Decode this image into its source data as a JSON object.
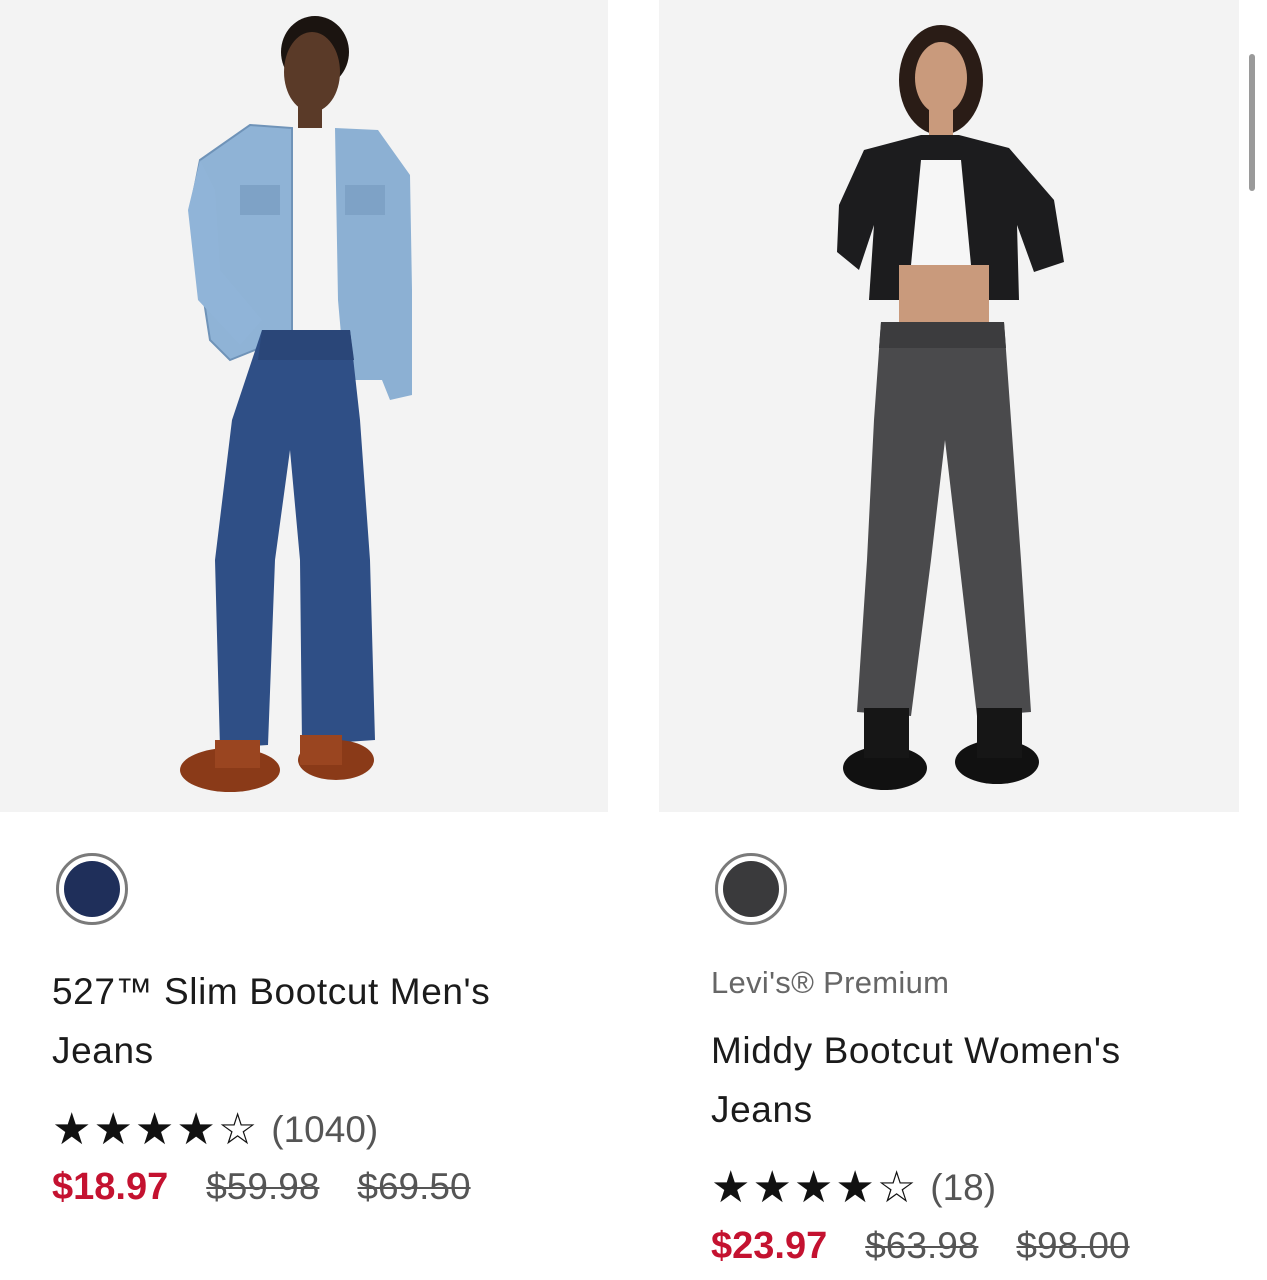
{
  "products": [
    {
      "brand": "",
      "title_line1": "527™ Slim Bootcut Men's",
      "title_line2": "Jeans",
      "rating_stars": 4,
      "rating_max": 5,
      "review_count": "(1040)",
      "sale_price": "$18.97",
      "original_prices": [
        "$59.98",
        "$69.50"
      ],
      "swatch_color": "#1f2f5a",
      "photo_alt": "Man in light denim jacket and bootcut jeans"
    },
    {
      "brand": "Levi's® Premium",
      "title_line1": "Middy Bootcut Women's",
      "title_line2": "Jeans",
      "rating_stars": 4,
      "rating_max": 5,
      "review_count": "(18)",
      "sale_price": "$23.97",
      "original_prices": [
        "$63.98",
        "$98.00"
      ],
      "swatch_color": "#3a3a3c",
      "photo_alt": "Woman in black cropped shirt and dark gray bootcut jeans"
    }
  ],
  "colors": {
    "sale": "#c41230",
    "photo_bg": "#f3f3f3"
  }
}
